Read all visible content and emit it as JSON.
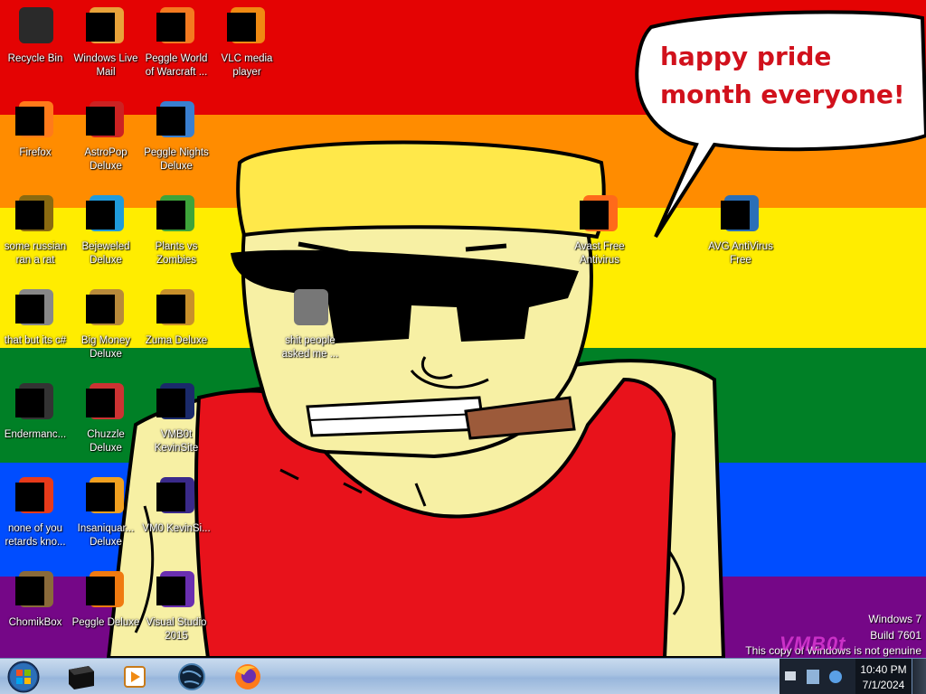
{
  "wallpaper": {
    "speech_bubble_text": "happy pride month everyone!",
    "colors": {
      "red": "#e40303",
      "orange": "#ff8c00",
      "yellow": "#ffed00",
      "green": "#008026",
      "blue": "#004dff",
      "purple": "#750787"
    }
  },
  "desktop": {
    "icons": [
      {
        "label": "Recycle Bin",
        "icon": "recycle-bin-icon"
      },
      {
        "label": "Windows Live Mail",
        "icon": "mail-icon"
      },
      {
        "label": "Peggle World of Warcraft ...",
        "icon": "peggle-icon"
      },
      {
        "label": "VLC media player",
        "icon": "vlc-icon"
      },
      {
        "label": "Firefox",
        "icon": "firefox-icon"
      },
      {
        "label": "AstroPop Deluxe",
        "icon": "astropop-icon"
      },
      {
        "label": "Peggle Nights Deluxe",
        "icon": "peggle-nights-icon"
      },
      {
        "label": "some russian ran a rat",
        "icon": "file-icon"
      },
      {
        "label": "Bejeweled Deluxe",
        "icon": "bejeweled-icon"
      },
      {
        "label": "Plants vs Zombies",
        "icon": "plants-vs-zombies-icon"
      },
      {
        "label": "Avast Free Antivirus",
        "icon": "avast-icon"
      },
      {
        "label": "AVG AntiVirus Free",
        "icon": "avg-icon"
      },
      {
        "label": "that but its c#",
        "icon": "windows-icon"
      },
      {
        "label": "Big Money Deluxe",
        "icon": "money-bag-icon"
      },
      {
        "label": "Zuma Deluxe",
        "icon": "zuma-icon"
      },
      {
        "label": "shit people asked me ...",
        "icon": "folder-icon"
      },
      {
        "label": "Endermanc...",
        "icon": "console-icon"
      },
      {
        "label": "Chuzzle Deluxe",
        "icon": "chuzzle-icon"
      },
      {
        "label": "VMB0t KevinSite",
        "icon": "web-icon"
      },
      {
        "label": "none of you retards kno...",
        "icon": "app-icon"
      },
      {
        "label": "Insaniquar... Deluxe",
        "icon": "fish-icon"
      },
      {
        "label": "VM0 KevinSi...",
        "icon": "web-icon"
      },
      {
        "label": "ChomikBox",
        "icon": "chomikbox-icon"
      },
      {
        "label": "Peggle Deluxe",
        "icon": "peggle-deluxe-icon"
      },
      {
        "label": "Visual Studio 2015",
        "icon": "visual-studio-icon"
      }
    ]
  },
  "watermark": {
    "line1": "Windows 7",
    "line2": "Build 7601",
    "line3": "This copy of Windows is not genuine",
    "overlay": "VMB0t"
  },
  "taskbar": {
    "pinned": [
      {
        "name": "recycle-app",
        "icon": "black-box-icon"
      },
      {
        "name": "media-player",
        "icon": "media-player-icon"
      },
      {
        "name": "globe-app",
        "icon": "globe-icon"
      },
      {
        "name": "firefox",
        "icon": "firefox-icon"
      }
    ],
    "clock": {
      "time": "10:40 PM",
      "date": "7/1/2024"
    }
  }
}
